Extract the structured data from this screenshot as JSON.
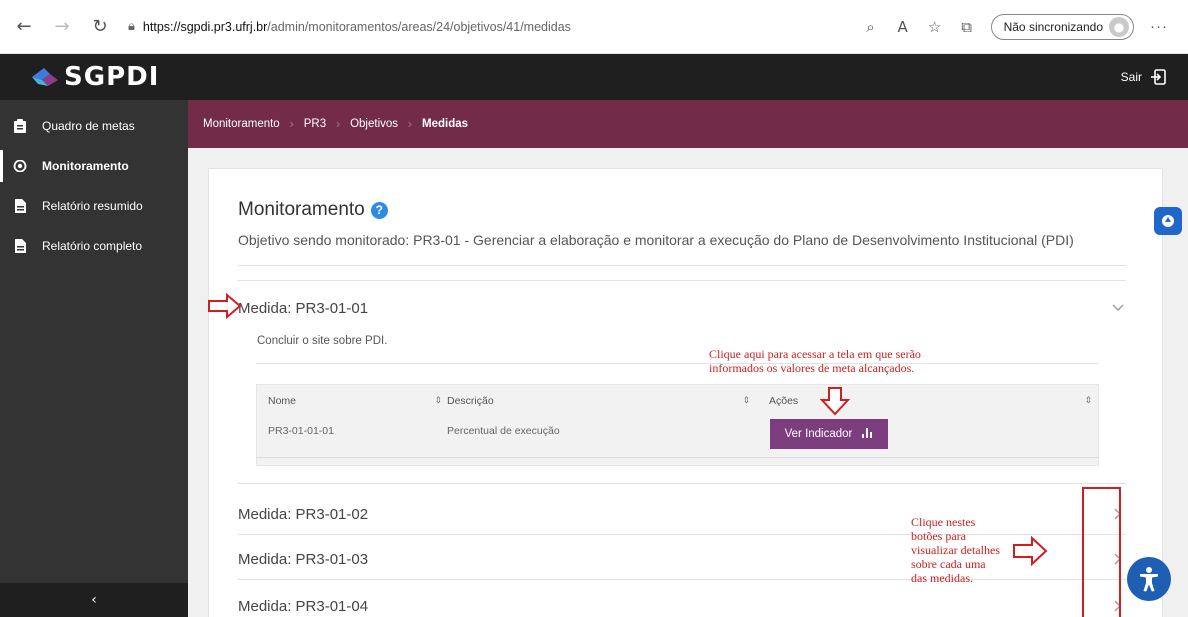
{
  "browser": {
    "url_host": "https://sgpdi.pr3.ufrj.br",
    "url_path": "/admin/monitoramentos/areas/24/objetivos/41/medidas",
    "sync_label": "Não sincronizando"
  },
  "sidebar": {
    "logo_text": "SGPDI",
    "items": [
      {
        "label": "Quadro de metas",
        "icon": "clipboard-icon"
      },
      {
        "label": "Monitoramento",
        "icon": "eye-icon"
      },
      {
        "label": "Relatório resumido",
        "icon": "document-icon"
      },
      {
        "label": "Relatório completo",
        "icon": "document-icon"
      }
    ]
  },
  "topbar": {
    "logout_label": "Sair"
  },
  "breadcrumb": [
    "Monitoramento",
    "PR3",
    "Objetivos",
    "Medidas"
  ],
  "main": {
    "title": "Monitoramento",
    "subtitle": "Objetivo sendo monitorado: PR3-01 - Gerenciar a elaboração e monitorar a execução do Plano de Desenvolvimento Institucional (PDI)",
    "measures": [
      {
        "title": "Medida: PR3-01-01",
        "description": "Concluir o site sobre PDI.",
        "table": {
          "headers": [
            "Nome",
            "Descrição",
            "Ações"
          ],
          "rows": [
            {
              "nome": "PR3-01-01-01",
              "descricao": "Percentual de execução",
              "action_label": "Ver Indicador"
            }
          ]
        }
      },
      {
        "title": "Medida: PR3-01-02"
      },
      {
        "title": "Medida: PR3-01-03"
      },
      {
        "title": "Medida: PR3-01-04"
      }
    ]
  },
  "annotations": {
    "action_hint_line1": "Clique aqui para acessar a tela em que serão",
    "action_hint_line2": "informados os valores de meta alcançados.",
    "expand_hint_lines": [
      "Clique nestes",
      "botões para",
      "visualizar detalhes",
      "sobre cada uma",
      "das medidas."
    ]
  },
  "colors": {
    "sidebar": "#333333",
    "topbar": "#1f1f1f",
    "breadcrumb": "#722c48",
    "action_button": "#7b3d7e",
    "annotation": "#cc1f1f",
    "help_icon": "#2f8be0"
  }
}
